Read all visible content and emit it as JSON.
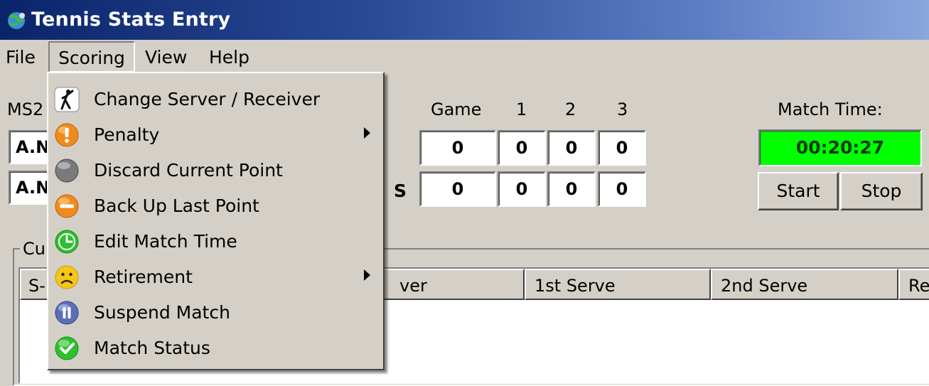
{
  "window": {
    "title": "Tennis Stats Entry"
  },
  "menubar": {
    "file": "File",
    "scoring": "Scoring",
    "view": "View",
    "help": "Help"
  },
  "match": {
    "code": "MS2"
  },
  "players": [
    {
      "name": "A.N",
      "serve_marker": ""
    },
    {
      "name": "A.N",
      "serve_marker": "S"
    }
  ],
  "scoreboard": {
    "headers": [
      "Game",
      "1",
      "2",
      "3"
    ],
    "rows": [
      [
        "0",
        "0",
        "0",
        "0"
      ],
      [
        "0",
        "0",
        "0",
        "0"
      ]
    ]
  },
  "timer": {
    "label": "Match Time:",
    "value": "00:20:27",
    "start_label": "Start",
    "stop_label": "Stop",
    "color": "#00ff00"
  },
  "current_group": {
    "label": "Cu"
  },
  "columns": [
    "S-",
    "ver",
    "1st Serve",
    "2nd Serve",
    "Re"
  ],
  "scoring_menu": {
    "items": [
      {
        "label": "Change Server / Receiver",
        "icon": "player-serving-icon",
        "has_submenu": false
      },
      {
        "label": "Penalty",
        "icon": "warning-icon",
        "has_submenu": true
      },
      {
        "label": "Discard Current Point",
        "icon": "gray-circle-icon",
        "has_submenu": false
      },
      {
        "label": "Back Up Last Point",
        "icon": "minus-circle-icon",
        "has_submenu": false
      },
      {
        "label": "Edit Match Time",
        "icon": "clock-icon",
        "has_submenu": false
      },
      {
        "label": "Retirement",
        "icon": "sad-face-icon",
        "has_submenu": true
      },
      {
        "label": "Suspend Match",
        "icon": "pause-icon",
        "has_submenu": false
      },
      {
        "label": "Match Status",
        "icon": "checkmark-icon",
        "has_submenu": false
      }
    ]
  }
}
